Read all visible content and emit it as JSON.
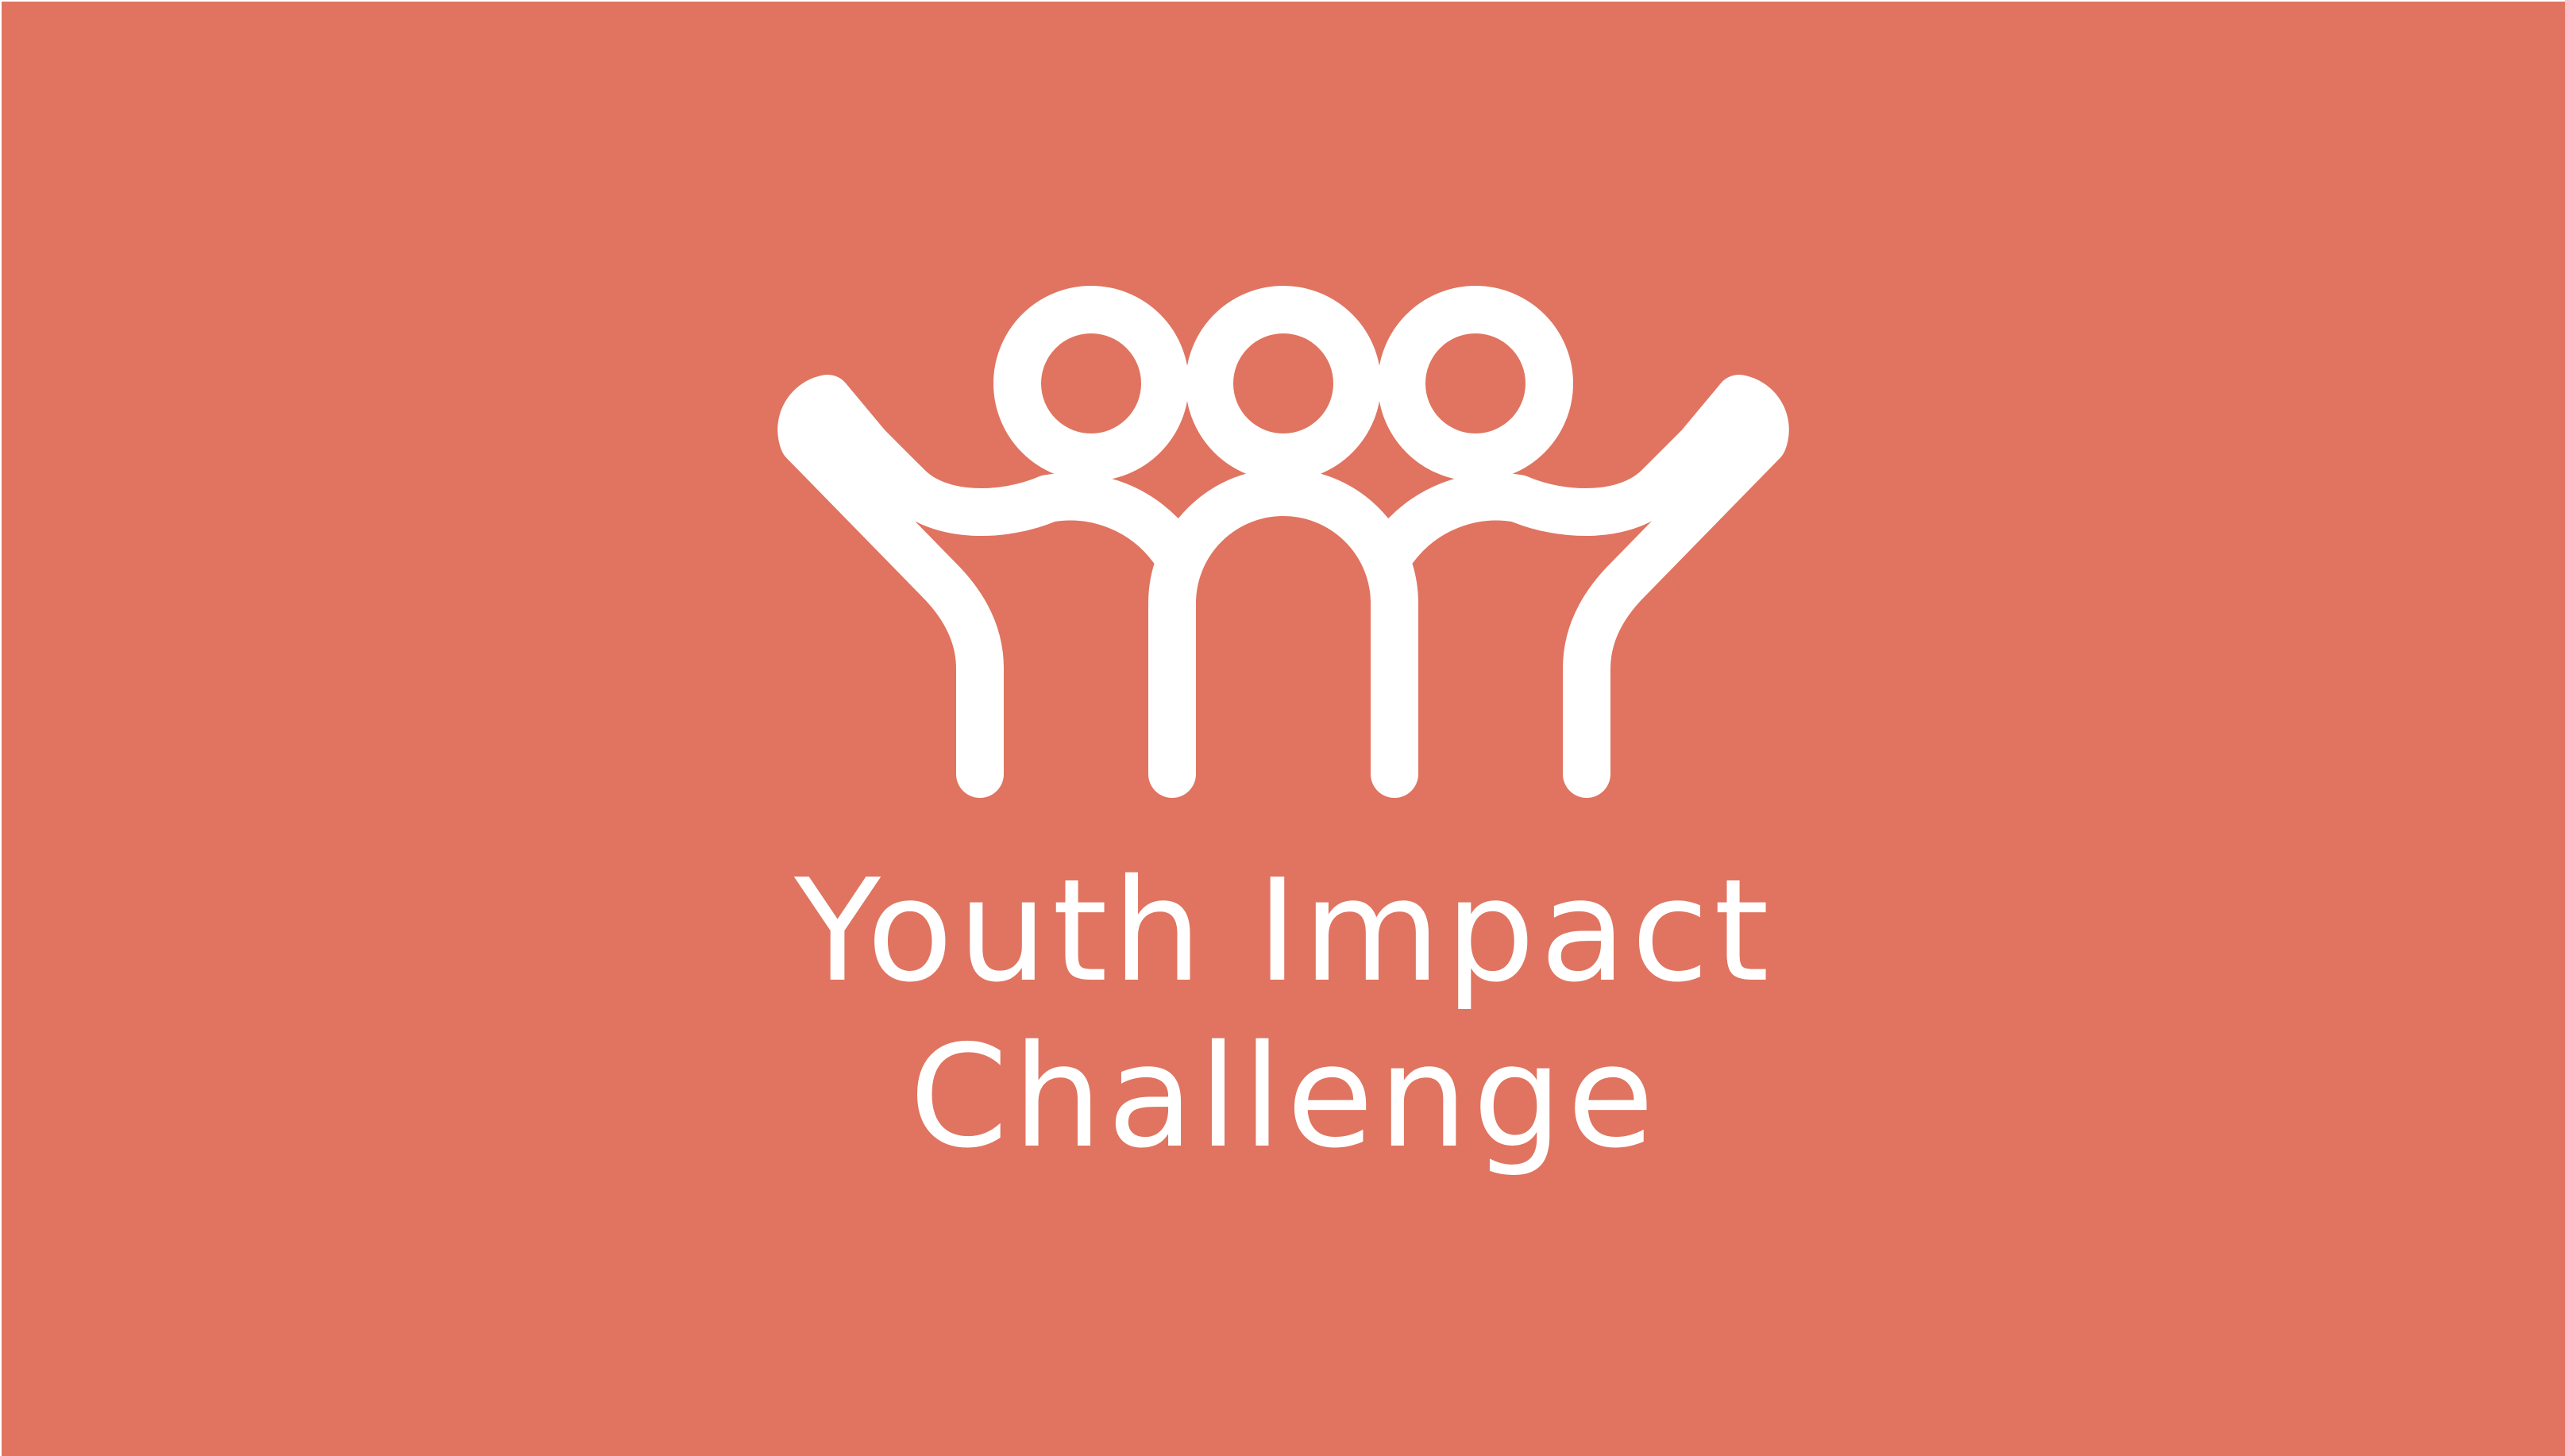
{
  "brand": {
    "title_line_1": "Youth Impact",
    "title_line_2": "Challenge",
    "logo_icon": "three-people-arms-raised-icon",
    "background_color": "#e07460",
    "foreground_color": "#ffffff"
  }
}
